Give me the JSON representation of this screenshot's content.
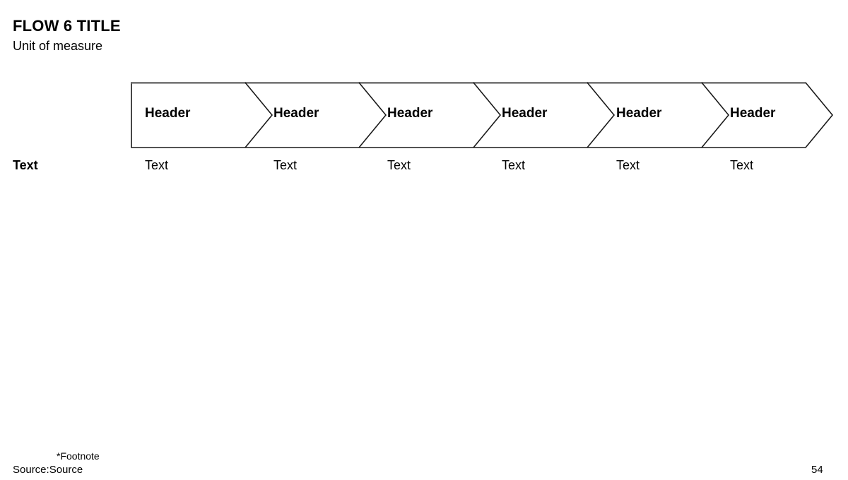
{
  "slide": {
    "title": "FLOW 6 TITLE",
    "subtitle": "Unit of measure",
    "page_number": "54"
  },
  "flow": {
    "segments": [
      {
        "header": "Header",
        "text": "Text"
      },
      {
        "header": "Header",
        "text": "Text"
      },
      {
        "header": "Header",
        "text": "Text"
      },
      {
        "header": "Header",
        "text": "Text"
      },
      {
        "header": "Header",
        "text": "Text"
      },
      {
        "header": "Header",
        "text": "Text"
      }
    ],
    "row_label": "Text",
    "colors": {
      "fill": "#ffffff",
      "outline": "#1a1a1a",
      "top_rule": "#787878",
      "text": "#000000"
    }
  },
  "footer": {
    "footnote": "*Footnote",
    "source": "Source:Source"
  }
}
